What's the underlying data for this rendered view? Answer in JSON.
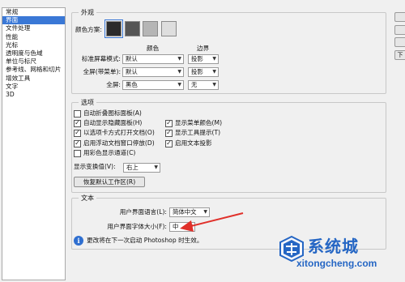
{
  "sidebar": {
    "items": [
      {
        "label": "常规",
        "active": false
      },
      {
        "label": "界面",
        "active": true
      },
      {
        "label": "文件处理",
        "active": false
      },
      {
        "label": "性能",
        "active": false
      },
      {
        "label": "光标",
        "active": false
      },
      {
        "label": "透明度与色域",
        "active": false
      },
      {
        "label": "单位与标尺",
        "active": false
      },
      {
        "label": "参考线、网格和切片",
        "active": false
      },
      {
        "label": "增效工具",
        "active": false
      },
      {
        "label": "文字",
        "active": false
      },
      {
        "label": "3D",
        "active": false
      }
    ]
  },
  "appearance": {
    "title": "外观",
    "color_scheme_label": "颜色方案:",
    "swatch_colors": [
      "#2b2b2b",
      "#555555",
      "#b5b5b5",
      "#dedede"
    ],
    "col_color": "颜色",
    "col_border": "边界",
    "rows": [
      {
        "label": "标准屏幕模式:",
        "color": "默认",
        "border": "投影"
      },
      {
        "label": "全屏(带菜单):",
        "color": "默认",
        "border": "投影"
      },
      {
        "label": "全屏:",
        "color": "黑色",
        "border": "无"
      }
    ]
  },
  "options": {
    "title": "选项",
    "left": [
      {
        "label": "自动折叠图标面板(A)",
        "checked": false
      },
      {
        "label": "自动显示隐藏面板(H)",
        "checked": true
      },
      {
        "label": "以选项卡方式打开文档(O)",
        "checked": true
      },
      {
        "label": "启用浮动文档窗口停放(D)",
        "checked": true
      },
      {
        "label": "用彩色显示通道(C)",
        "checked": false
      }
    ],
    "right": [
      {
        "label": "显示菜单颜色(M)",
        "checked": true
      },
      {
        "label": "显示工具提示(T)",
        "checked": true
      },
      {
        "label": "启用文本投影",
        "checked": true
      }
    ],
    "transform_label": "显示变换值(V):",
    "transform_value": "右上",
    "reset_button": "恢复默认工作区(R)"
  },
  "text": {
    "title": "文本",
    "ui_language_label": "用户界面语言(L):",
    "ui_language_value": "简体中文",
    "ui_font_size_label": "用户界面字体大小(F):",
    "ui_font_size_value": "中",
    "notice": "更改将在下一次启动 Photoshop 时生效。"
  },
  "right_buttons": [
    "",
    "",
    "",
    "下"
  ],
  "watermark": {
    "name": "系统城",
    "url": "xitongcheng.com",
    "accent_color": "#2566c4",
    "arrow_color": "#e0302a"
  }
}
